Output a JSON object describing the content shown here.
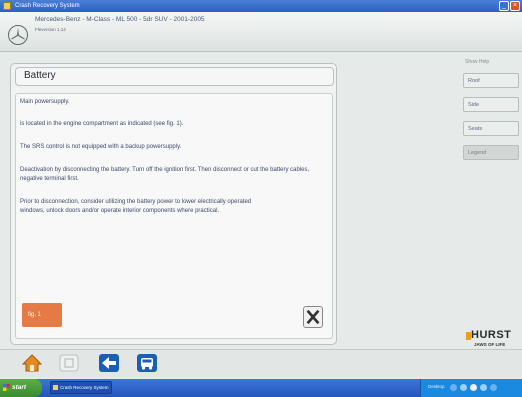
{
  "window": {
    "title": "Crash Recovery System",
    "buttons": {
      "minimize": "_",
      "close": "×"
    }
  },
  "header": {
    "vehicle": "Mercedes-Benz - M-Class - ML 500 - 5dr SUV - 2001-2005",
    "version": "Fleversion 1.14"
  },
  "panel": {
    "title": "Battery",
    "paragraphs": [
      "Main powersupply.",
      "is located in the engine compartment as indicated (see fig. 1).",
      "The SRS control is not equipped with a backup powersupply.",
      "Deactivation by disconnecting the battery. Turn off the ignition first. Then disconnect or cut the battery cables, negative terminal first.",
      "Prior to disconnection, consider utilizing the battery power to lower electrically operated windows, unlock doors and/or operate interior components where practical."
    ],
    "fig_button": "fig. 1"
  },
  "show": {
    "label": "Show Help",
    "buttons": [
      {
        "label": "Roof",
        "enabled": true
      },
      {
        "label": "Side",
        "enabled": true
      },
      {
        "label": "Seats",
        "enabled": true
      },
      {
        "label": "Legend",
        "enabled": false
      }
    ]
  },
  "brand": {
    "name": "HURST",
    "tagline": "JAWS OF LIFE"
  },
  "toolbar": {
    "icons": [
      "home-icon",
      "stop-icon",
      "back-arrow-icon",
      "vehicle-icon"
    ]
  },
  "taskbar": {
    "start_label": "start",
    "task_label": "Crash Recovery System",
    "tray_text": "Desktop"
  },
  "colors": {
    "accent_orange": "#e67a45",
    "header_text": "#4a5a7a",
    "taskbar_blue": "#2456bc"
  }
}
